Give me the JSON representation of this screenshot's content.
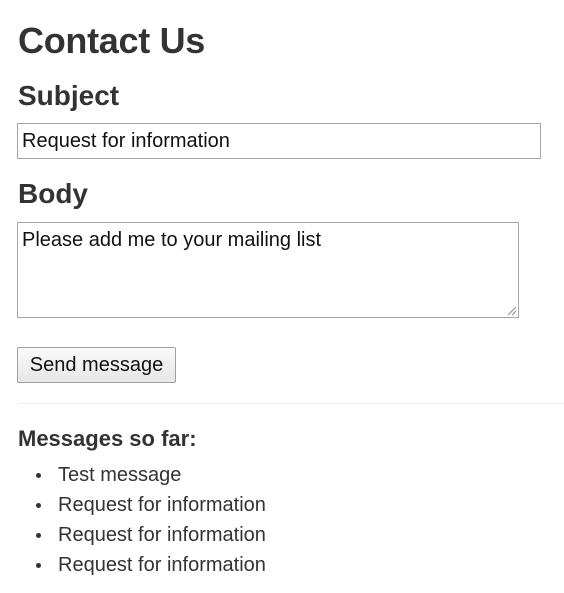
{
  "page": {
    "title": "Contact Us"
  },
  "form": {
    "subject_label": "Subject",
    "subject_value": "Request for information",
    "body_label": "Body",
    "body_value": "Please add me to your mailing list",
    "send_label": "Send message"
  },
  "messages": {
    "heading": "Messages so far:",
    "items": [
      "Test message",
      "Request for information",
      "Request for information",
      "Request for information"
    ]
  }
}
